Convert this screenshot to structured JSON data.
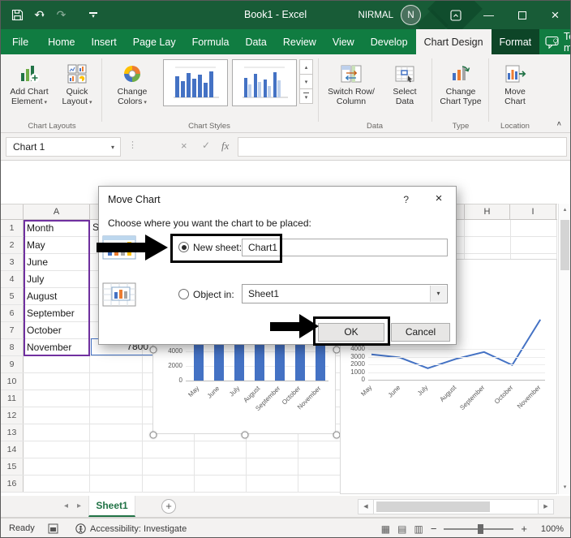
{
  "colors": {
    "titlebar_green": "#185C37",
    "tab_row_green": "#107C41",
    "format_tab_green": "#0D4527",
    "accent_blue": "#4472C4",
    "excel_green": "#217346",
    "range_highlight_purple": "#7030A0",
    "annotation_black": "#000000"
  },
  "titlebar": {
    "title": "Book1 - Excel",
    "user_name": "NIRMAL",
    "avatar_initial": "N"
  },
  "ribbon_tabs": {
    "file": "File",
    "items": [
      "Home",
      "Insert",
      "Page Lay",
      "Formula",
      "Data",
      "Review",
      "View",
      "Develop"
    ],
    "active_tab": "Chart Design",
    "contextual_tab": "Format",
    "tell_me": "Tell me"
  },
  "ribbon": {
    "add_chart_element": {
      "line1": "Add Chart",
      "line2": "Element"
    },
    "quick_layout": {
      "line1": "Quick",
      "line2": "Layout"
    },
    "change_colors": {
      "line1": "Change",
      "line2": "Colors"
    },
    "switch_row_column": {
      "line1": "Switch Row/",
      "line2": "Column"
    },
    "select_data": {
      "line1": "Select",
      "line2": "Data"
    },
    "change_chart_type": {
      "line1": "Change",
      "line2": "Chart Type"
    },
    "move_chart": {
      "line1": "Move",
      "line2": "Chart"
    },
    "groups": {
      "chart_layouts": "Chart Layouts",
      "chart_styles": "Chart Styles",
      "data": "Data",
      "type": "Type",
      "location": "Location"
    }
  },
  "formula_bar": {
    "name_box": "Chart 1",
    "fx_label": "fx"
  },
  "dialog": {
    "title": "Move Chart",
    "help": "?",
    "prompt": "Choose where you want the chart to be placed:",
    "new_sheet_label": "New sheet:",
    "new_sheet_value": "Chart1",
    "object_in_label": "Object in:",
    "object_in_value": "Sheet1",
    "ok_label": "OK",
    "cancel_label": "Cancel"
  },
  "sheet": {
    "column_headers": {
      "a": "A",
      "h": "H",
      "i": "I"
    },
    "b1_partial": "Sa",
    "b8_value": "7800",
    "rows": [
      {
        "n": "1",
        "a": "Month"
      },
      {
        "n": "2",
        "a": "May"
      },
      {
        "n": "3",
        "a": "June"
      },
      {
        "n": "4",
        "a": "July"
      },
      {
        "n": "5",
        "a": "August"
      },
      {
        "n": "6",
        "a": "September"
      },
      {
        "n": "7",
        "a": "October"
      },
      {
        "n": "8",
        "a": "November"
      },
      {
        "n": "9",
        "a": ""
      },
      {
        "n": "10",
        "a": ""
      },
      {
        "n": "11",
        "a": ""
      },
      {
        "n": "12",
        "a": ""
      },
      {
        "n": "13",
        "a": ""
      },
      {
        "n": "14",
        "a": ""
      },
      {
        "n": "15",
        "a": ""
      },
      {
        "n": "16",
        "a": ""
      }
    ]
  },
  "chart_data": [
    {
      "type": "bar",
      "title": "",
      "categories": [
        "May",
        "June",
        "July",
        "August",
        "September",
        "October",
        "November"
      ],
      "values": [
        6200,
        6800,
        6400,
        7000,
        6600,
        6900,
        7800
      ],
      "y_ticks": [
        0,
        2000,
        4000
      ],
      "ylim": [
        0,
        8000
      ],
      "series_color": "#4472C4",
      "note": "embedded column chart; upper portion hidden behind Move Chart dialog"
    },
    {
      "type": "line",
      "title": "",
      "categories": [
        "May",
        "June",
        "July",
        "August",
        "September",
        "October",
        "November"
      ],
      "values": [
        3300,
        2900,
        1500,
        2700,
        3600,
        1900,
        7800
      ],
      "y_ticks": [
        0,
        1000,
        2000,
        3000,
        4000
      ],
      "ylim": [
        0,
        8000
      ],
      "series_color": "#4472C4",
      "note": "embedded line chart; upper-left portion hidden behind dialog"
    }
  ],
  "sheet_tabs": {
    "active": "Sheet1"
  },
  "status_bar": {
    "ready": "Ready",
    "accessibility": "Accessibility: Investigate",
    "zoom_level": "100%"
  },
  "icons": {
    "dropdown": "▾",
    "undo": "↶",
    "redo": "↷",
    "close": "×",
    "minimize": "—",
    "check": "✓",
    "cancel_x": "×",
    "scroll_up": "▴",
    "scroll_down": "▾",
    "scroll_left": "◀",
    "scroll_right": "▶",
    "tab_nav_left": "◂",
    "tab_nav_right": "▸",
    "collapse_ribbon": "∧",
    "plus": "+",
    "minus": "−",
    "ellipsis": "⋮",
    "view_normal": "▦",
    "view_page_layout": "▤",
    "view_page_break": "▥"
  }
}
